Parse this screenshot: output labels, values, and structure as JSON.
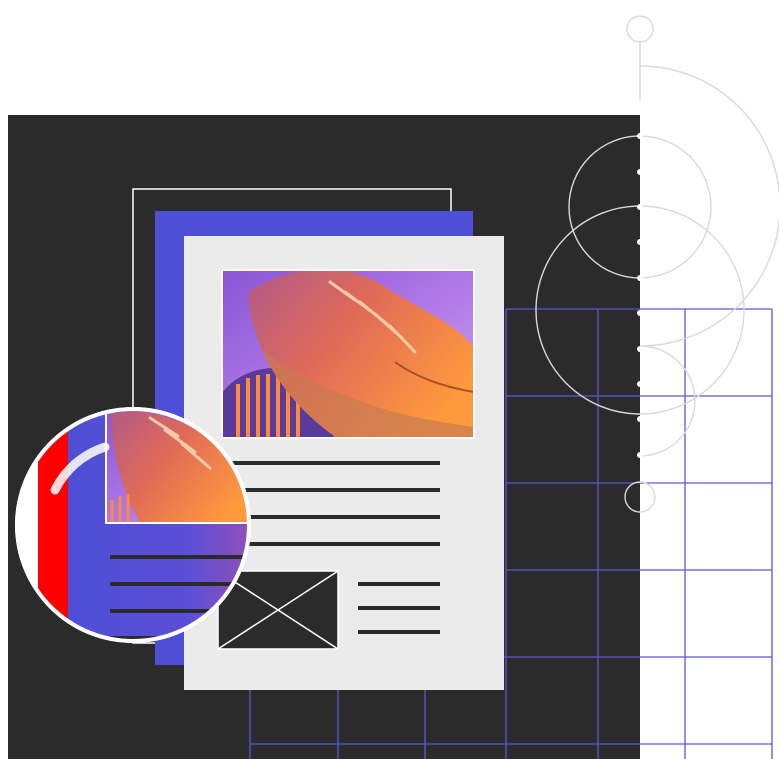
{
  "illustration": {
    "subject": "shoe-photo",
    "colors": {
      "dark_panel": "#2b2b2b",
      "accent_blue": "#4d4fd6",
      "grid_line": "#5a58d8",
      "page_gray": "#ebebeb",
      "line_dark": "#2b2b2b",
      "lens_red": "#ff0000",
      "shoe_orange": "#ff8a3a",
      "photo_purple": "#9c6be0"
    },
    "icons": [
      "image-placeholder-icon",
      "magnifier-lens"
    ]
  }
}
